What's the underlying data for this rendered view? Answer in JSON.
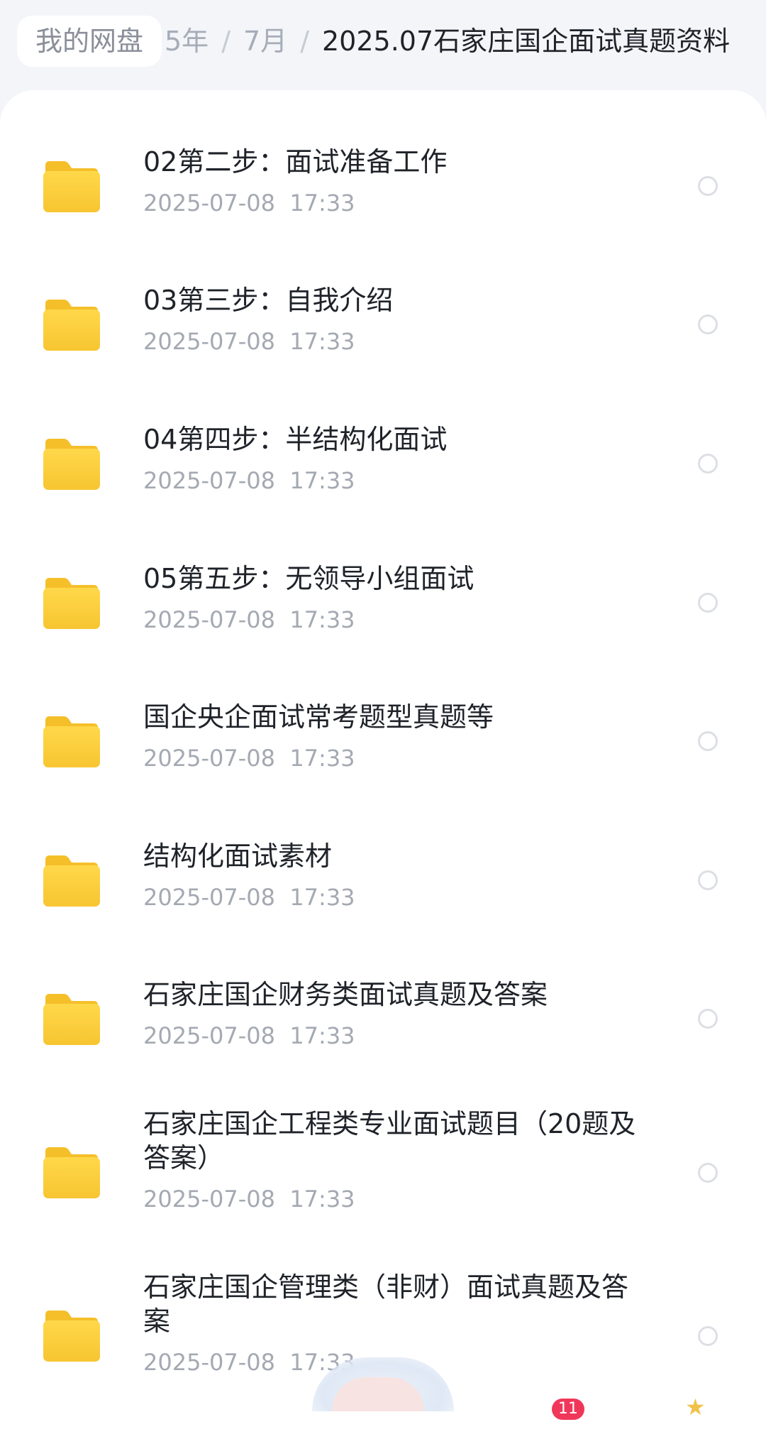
{
  "breadcrumb": {
    "root": "我的网盘",
    "year_fragment": "5年",
    "month": "7月",
    "current": "2025.07石家庄国企面试真题资料",
    "separator": "/"
  },
  "files": [
    {
      "name": "02第二步：面试准备工作",
      "time": "2025-07-08  17:33"
    },
    {
      "name": "03第三步：自我介绍",
      "time": "2025-07-08  17:33"
    },
    {
      "name": "04第四步：半结构化面试",
      "time": "2025-07-08  17:33"
    },
    {
      "name": "05第五步：无领导小组面试",
      "time": "2025-07-08  17:33"
    },
    {
      "name": "国企央企面试常考题型真题等",
      "time": "2025-07-08  17:33"
    },
    {
      "name": "结构化面试素材",
      "time": "2025-07-08  17:33"
    },
    {
      "name": "石家庄国企财务类面试真题及答案",
      "time": "2025-07-08  17:33"
    },
    {
      "name": "石家庄国企工程类专业面试题目（20题及答案）",
      "time": "2025-07-08  17:33"
    },
    {
      "name": "石家庄国企管理类（非财）面试真题及答案",
      "time": "2025-07-08  17:33"
    }
  ],
  "bottom_badge": "11",
  "colors": {
    "folder_top": "#ffd84a",
    "folder_bottom": "#f7c531",
    "badge": "#f0375a"
  },
  "icons": {
    "folder": "folder-icon",
    "select": "select-circle-icon",
    "star": "star-icon"
  }
}
